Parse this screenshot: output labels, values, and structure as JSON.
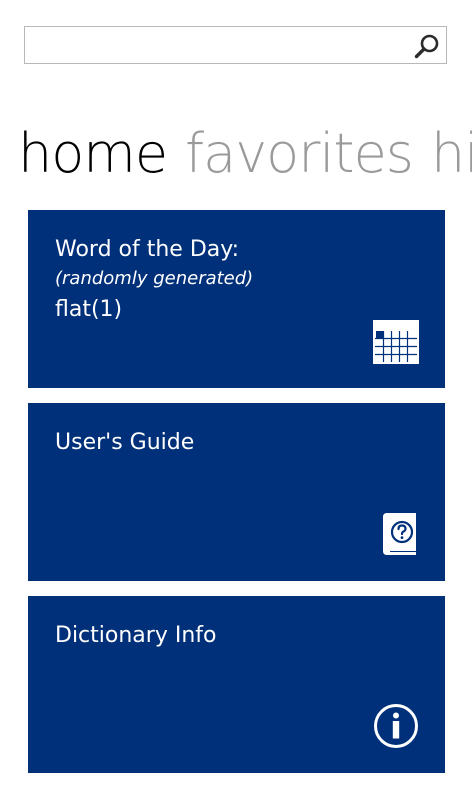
{
  "search": {
    "value": "",
    "placeholder": "",
    "icon": "search-icon"
  },
  "pivot": {
    "items": [
      "home",
      "favorites",
      "history"
    ],
    "active_index": 0
  },
  "tiles": {
    "word_of_day": {
      "title": "Word of the Day:",
      "subtitle": "(randomly generated)",
      "word": "flat(1)",
      "icon": "calendar-icon"
    },
    "users_guide": {
      "title": "User's Guide",
      "icon": "help-book-icon"
    },
    "dictionary_info": {
      "title": "Dictionary Info",
      "icon": "info-icon"
    }
  },
  "colors": {
    "tile_background": "#00307a",
    "tile_text": "#ffffff",
    "pivot_active": "#000000",
    "pivot_inactive": "#9a9a9a"
  }
}
